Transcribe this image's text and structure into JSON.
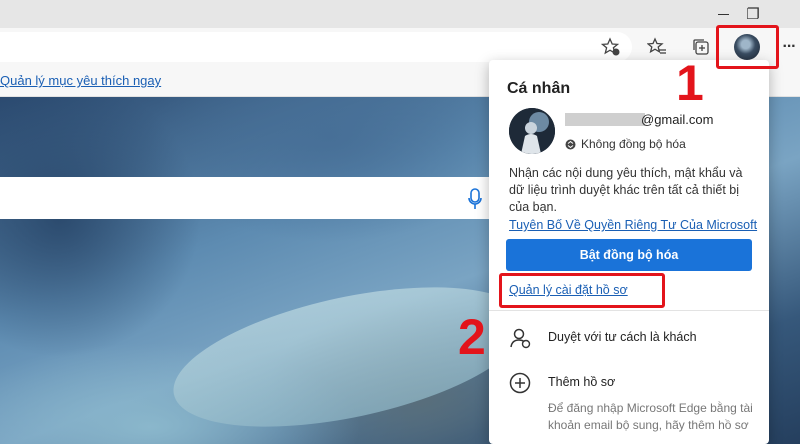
{
  "favorites_bar": {
    "manage_link": "Quản lý mục yêu thích ngay"
  },
  "window_controls": {
    "restore_label": "❐"
  },
  "toolbar": {
    "more_label": "···"
  },
  "profile_panel": {
    "title": "Cá nhân",
    "email_suffix": "@gmail.com",
    "sync_status": "Không đồng bộ hóa",
    "description": "Nhận các nội dung yêu thích, mật khẩu và dữ liệu trình duyệt khác trên tất cả thiết bị của bạn.",
    "privacy_link": "Tuyên Bố Về Quyền Riêng Tư Của Microsoft",
    "sync_button": "Bật đồng bộ hóa",
    "manage_profile_link": "Quản lý cài đặt hồ sơ",
    "guest_label": "Duyệt với tư cách là khách",
    "add_profile_label": "Thêm hồ sơ",
    "add_profile_desc": "Để đăng nhập Microsoft Edge bằng tài khoản email bộ sung, hãy thêm hồ sơ"
  },
  "annotations": {
    "step1": "1",
    "step2": "2"
  },
  "colors": {
    "accent": "#1a73d9",
    "highlight": "#e3141b"
  }
}
